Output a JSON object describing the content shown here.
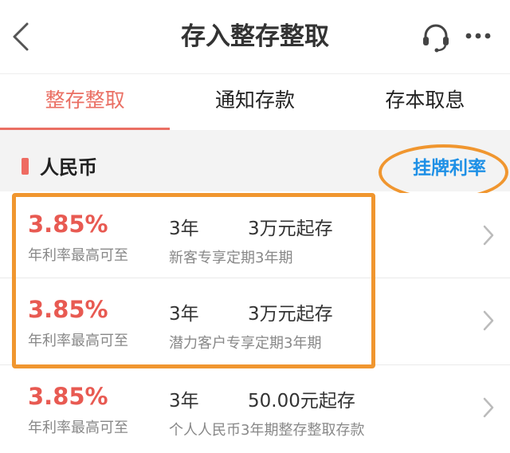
{
  "header": {
    "title": "存入整存整取",
    "back_icon": "back-icon",
    "service_icon": "headset-icon",
    "more_icon": "more-icon"
  },
  "tabs": [
    {
      "label": "整存整取",
      "active": true
    },
    {
      "label": "通知存款",
      "active": false
    },
    {
      "label": "存本取息",
      "active": false
    }
  ],
  "section": {
    "title": "人民币",
    "link": "挂牌利率"
  },
  "products": [
    {
      "rate": "3.85%",
      "rate_label": "年利率最高可至",
      "term": "3年",
      "amount": "3万元起存",
      "desc": "新客专享定期3年期"
    },
    {
      "rate": "3.85%",
      "rate_label": "年利率最高可至",
      "term": "3年",
      "amount": "3万元起存",
      "desc": "潜力客户专享定期3年期"
    },
    {
      "rate": "3.85%",
      "rate_label": "年利率最高可至",
      "term": "3年",
      "amount": "50.00元起存",
      "desc": "个人人民币3年期整存整取存款"
    }
  ],
  "colors": {
    "accent": "#ea6f63",
    "rate": "#e85a52",
    "link": "#1e90e6",
    "annotation": "#f0962f"
  }
}
